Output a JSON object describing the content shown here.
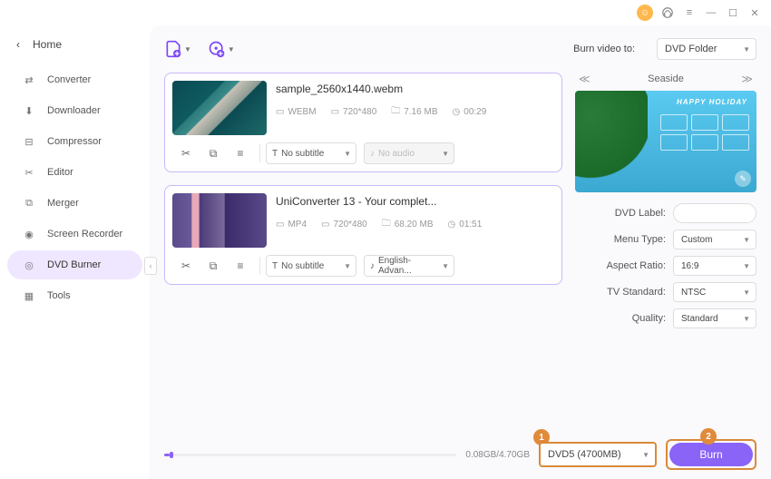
{
  "titlebar": {
    "avatar": "",
    "support": "",
    "menu": "",
    "min": "",
    "max": "",
    "close": ""
  },
  "home_label": "Home",
  "nav": [
    {
      "label": "Converter"
    },
    {
      "label": "Downloader"
    },
    {
      "label": "Compressor"
    },
    {
      "label": "Editor"
    },
    {
      "label": "Merger"
    },
    {
      "label": "Screen Recorder"
    },
    {
      "label": "DVD Burner"
    },
    {
      "label": "Tools"
    }
  ],
  "burn_to_label": "Burn video to:",
  "burn_to_value": "DVD Folder",
  "files": [
    {
      "name": "sample_2560x1440.webm",
      "fmt": "WEBM",
      "res": "720*480",
      "size": "7.16 MB",
      "dur": "00:29",
      "subtitle": "No subtitle",
      "audio": "No audio",
      "audio_disabled": true
    },
    {
      "name": "UniConverter 13 - Your complet...",
      "fmt": "MP4",
      "res": "720*480",
      "size": "68.20 MB",
      "dur": "01:51",
      "subtitle": "No subtitle",
      "audio": "English-Advan...",
      "audio_disabled": false
    }
  ],
  "theme": {
    "name": "Seaside",
    "banner": "HAPPY HOLIDAY"
  },
  "settings": {
    "dvd_label_lbl": "DVD Label:",
    "dvd_label_val": "",
    "menu_type_lbl": "Menu Type:",
    "menu_type_val": "Custom",
    "aspect_lbl": "Aspect Ratio:",
    "aspect_val": "16:9",
    "tv_lbl": "TV Standard:",
    "tv_val": "NTSC",
    "quality_lbl": "Quality:",
    "quality_val": "Standard"
  },
  "progress_text": "0.08GB/4.70GB",
  "disc_value": "DVD5 (4700MB)",
  "burn_label": "Burn",
  "callout1": "1",
  "callout2": "2"
}
